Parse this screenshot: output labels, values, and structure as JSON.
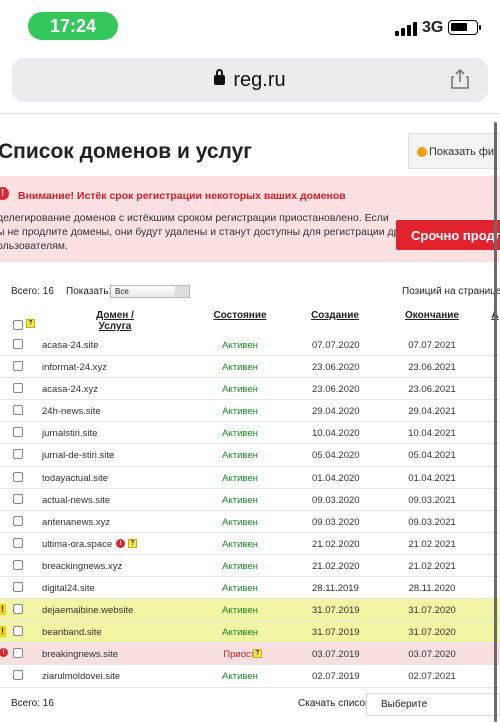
{
  "status": {
    "time": "17:24",
    "network": "3G"
  },
  "browser": {
    "url": "reg.ru"
  },
  "page": {
    "title": "Список доменов и услуг",
    "filter_button": "Показать фи",
    "alert": {
      "heading": "Внимание! Истёк срок регистрации некоторых ваших доменов",
      "lines": [
        "делегирование доменов с истёкшим сроком регистрации приостановлено. Если",
        "ы не продлите домены, они будут удалены и станут доступны для регистрации другим",
        "ользователям."
      ],
      "renew_button": "Срочно продли"
    },
    "toolbar": {
      "total": "Всего: 16",
      "show_label": "Показать:",
      "show_value": "Все",
      "per_page": "Позиций на странице:"
    },
    "columns": {
      "domain": "Домен / Услуга",
      "state": "Состояние",
      "created": "Создание",
      "expires": "Окончание",
      "extra": "А"
    },
    "rows": [
      {
        "domain": "acasa-24.site",
        "state": "Активен",
        "created": "07.07.2020",
        "expires": "07.07.2021",
        "kind": "normal"
      },
      {
        "domain": "informat-24.xyz",
        "state": "Активен",
        "created": "23.06.2020",
        "expires": "23.06.2021",
        "kind": "normal"
      },
      {
        "domain": "acasa-24.xyz",
        "state": "Активен",
        "created": "23.06.2020",
        "expires": "23.06.2021",
        "kind": "normal"
      },
      {
        "domain": "24h-news.site",
        "state": "Активен",
        "created": "29.04.2020",
        "expires": "29.04.2021",
        "kind": "normal"
      },
      {
        "domain": "jurnalstiri.site",
        "state": "Активен",
        "created": "10.04.2020",
        "expires": "10.04.2021",
        "kind": "normal"
      },
      {
        "domain": "jurnal-de-stiri.site",
        "state": "Активен",
        "created": "05.04.2020",
        "expires": "05.04.2021",
        "kind": "normal"
      },
      {
        "domain": "todayactual.site",
        "state": "Активен",
        "created": "01.04.2020",
        "expires": "01.04.2021",
        "kind": "normal"
      },
      {
        "domain": "actual-news.site",
        "state": "Активен",
        "created": "09.03.2020",
        "expires": "09.03.2021",
        "kind": "normal"
      },
      {
        "domain": "antenanews.xyz",
        "state": "Активен",
        "created": "09.03.2020",
        "expires": "09.03.2021",
        "kind": "normal"
      },
      {
        "domain": "ultima-ora.space",
        "state": "Активен",
        "created": "21.02.2020",
        "expires": "21.02.2021",
        "kind": "normal",
        "icons": true
      },
      {
        "domain": "breackingnews.xyz",
        "state": "Активен",
        "created": "21.02.2020",
        "expires": "21.02.2021",
        "kind": "normal"
      },
      {
        "domain": "digital24.site",
        "state": "Активен",
        "created": "28.11.2019",
        "expires": "28.11.2020",
        "kind": "normal"
      },
      {
        "domain": "dejaemaibine.website",
        "state": "Активен",
        "created": "31.07.2019",
        "expires": "31.07.2020",
        "kind": "warn"
      },
      {
        "domain": "beanband.site",
        "state": "Активен",
        "created": "31.07.2019",
        "expires": "31.07.2020",
        "kind": "warn"
      },
      {
        "domain": "breakingnews.site",
        "state": "Приост.",
        "created": "03.07.2019",
        "expires": "03.07.2020",
        "kind": "err"
      },
      {
        "domain": "ziarulmoldovei.site",
        "state": "Активен",
        "created": "02.07.2019",
        "expires": "02.07.2021",
        "kind": "normal"
      }
    ],
    "footer": {
      "total": "Всего: 16",
      "download_label": "Скачать список:",
      "download_value": "Выберите"
    }
  }
}
